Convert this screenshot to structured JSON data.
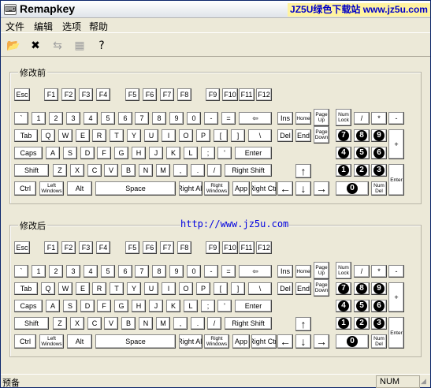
{
  "window": {
    "title": "Remapkey",
    "watermark": "JZ5U绿色下载站 www.jz5u.com"
  },
  "menu": [
    "文件",
    "编辑",
    "选项",
    "帮助"
  ],
  "toolbar": [
    {
      "name": "load-icon",
      "glyph": "📂",
      "disabled": false
    },
    {
      "name": "reset-icon",
      "glyph": "✖",
      "disabled": false
    },
    {
      "name": "swap-icon",
      "glyph": "⇆",
      "disabled": true
    },
    {
      "name": "grid-icon",
      "glyph": "▦",
      "disabled": true
    },
    {
      "name": "help-icon",
      "glyph": "?",
      "disabled": false
    }
  ],
  "groups": [
    {
      "title": "修改前"
    },
    {
      "title": "修改后"
    }
  ],
  "url": "http://www.jz5u.com",
  "keys": {
    "esc": "Esc",
    "f1": "F1",
    "f2": "F2",
    "f3": "F3",
    "f4": "F4",
    "f5": "F5",
    "f6": "F6",
    "f7": "F7",
    "f8": "F8",
    "f9": "F9",
    "f10": "F10",
    "f11": "F11",
    "f12": "F12",
    "grave": "`",
    "d1": "1",
    "d2": "2",
    "d3": "3",
    "d4": "4",
    "d5": "5",
    "d6": "6",
    "d7": "7",
    "d8": "8",
    "d9": "9",
    "d0": "0",
    "minus": "-",
    "equal": "=",
    "bksp": "⇦",
    "tab": "Tab",
    "q": "Q",
    "w": "W",
    "e": "E",
    "r": "R",
    "t": "T",
    "y": "Y",
    "u": "U",
    "i": "I",
    "o": "O",
    "p": "P",
    "lbr": "[",
    "rbr": "]",
    "bslash": "\\",
    "caps": "Caps",
    "a": "A",
    "s": "S",
    "d": "D",
    "f": "F",
    "g": "G",
    "h": "H",
    "j": "J",
    "k": "K",
    "l": "L",
    "semi": ";",
    "quote": "'",
    "enter": "Enter",
    "lshift": "Shift",
    "z": "Z",
    "x": "X",
    "c": "C",
    "v": "V",
    "b": "B",
    "n": "N",
    "m": "M",
    "comma": ",",
    "period": ".",
    "slash": "/",
    "rshift": "Right Shift",
    "ctrl": "Ctrl",
    "lwin": "Left Windows",
    "alt": "Alt",
    "space": "Space",
    "ralt": "Right Alt",
    "rwin": "Right Windows",
    "app": "App",
    "rctrl": "Right Ctrl",
    "ins": "Ins",
    "home": "Home",
    "pgup": "Page Up",
    "del": "Del",
    "end": "End",
    "pgdn": "Page Down",
    "up": "↑",
    "left": "←",
    "down": "↓",
    "right": "→",
    "numlock": "Num Lock",
    "ndiv": "/",
    "nmul": "*",
    "nsub": "-",
    "nadd": "+",
    "nenter": "Enter",
    "ndel": "Num Del",
    "n7": "7",
    "n8": "8",
    "n9": "9",
    "n4": "4",
    "n5": "5",
    "n6": "6",
    "n1": "1",
    "n2": "2",
    "n3": "3",
    "n0": "0"
  },
  "status": {
    "text": "预备",
    "num": "NUM"
  }
}
